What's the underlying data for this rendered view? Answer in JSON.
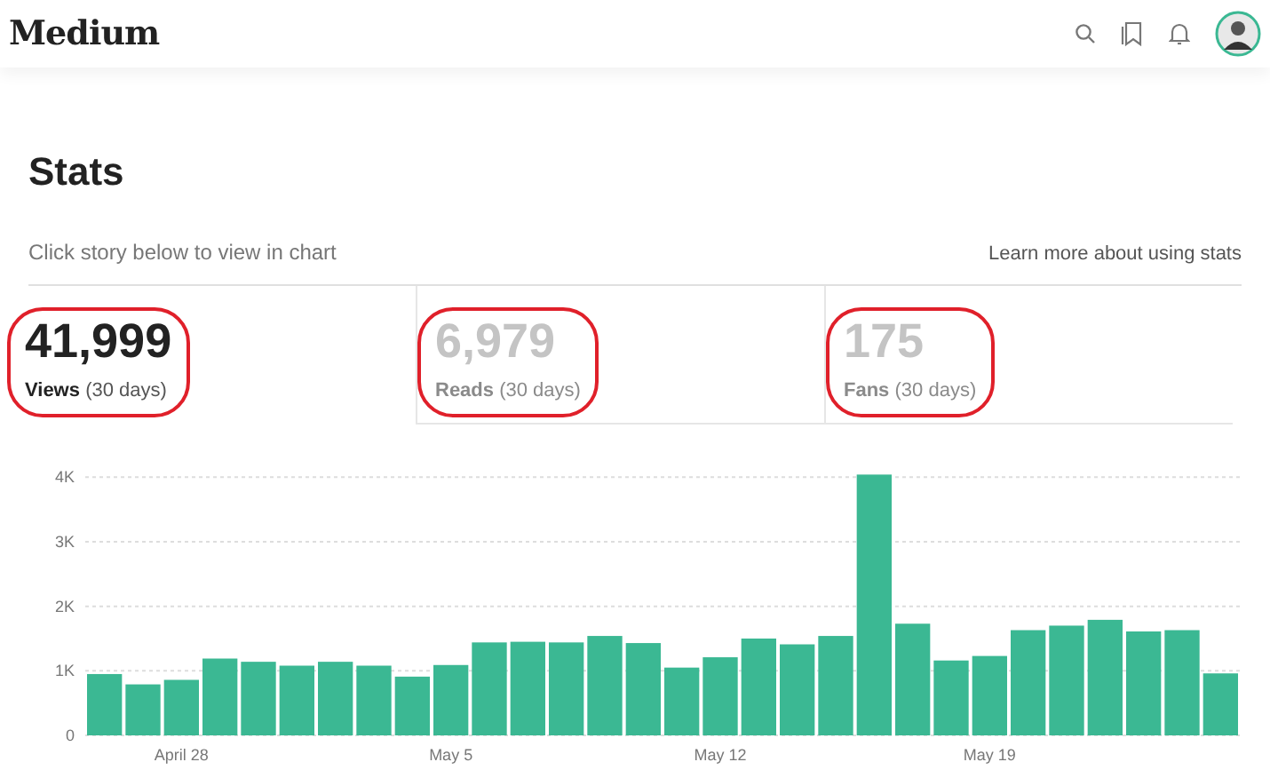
{
  "header": {
    "logo": "Medium"
  },
  "page": {
    "title": "Stats",
    "hint": "Click story below to view in chart",
    "help_link": "Learn more about using stats"
  },
  "stats": [
    {
      "value": "41,999",
      "label": "Views",
      "period": "(30 days)",
      "selected": true,
      "highlighted": true
    },
    {
      "value": "6,979",
      "label": "Reads",
      "period": "(30 days)",
      "selected": false,
      "highlighted": true
    },
    {
      "value": "175",
      "label": "Fans",
      "period": "(30 days)",
      "selected": false,
      "highlighted": true
    }
  ],
  "chart": {
    "chart_data": {
      "type": "bar",
      "ylim": [
        0,
        4100
      ],
      "grid": true,
      "yticks": [
        {
          "value": 0,
          "label": "0"
        },
        {
          "value": 1000,
          "label": "1K"
        },
        {
          "value": 2000,
          "label": "2K"
        },
        {
          "value": 3000,
          "label": "3K"
        },
        {
          "value": 4000,
          "label": "4K"
        }
      ],
      "categories": [
        null,
        null,
        "April 28",
        null,
        null,
        null,
        null,
        null,
        null,
        "May 5",
        null,
        null,
        null,
        null,
        null,
        null,
        "May 12",
        null,
        null,
        null,
        null,
        null,
        null,
        "May 19",
        null,
        null,
        null,
        null,
        null,
        null
      ],
      "series": [
        {
          "color": "#3bb893",
          "values": [
            950,
            790,
            860,
            1190,
            1140,
            1080,
            1140,
            1080,
            910,
            1090,
            1440,
            1450,
            1440,
            1540,
            1430,
            1050,
            1210,
            1500,
            1410,
            1540,
            4040,
            1730,
            1160,
            1230,
            1630,
            1700,
            1790,
            1610,
            1630,
            960
          ]
        }
      ]
    }
  }
}
